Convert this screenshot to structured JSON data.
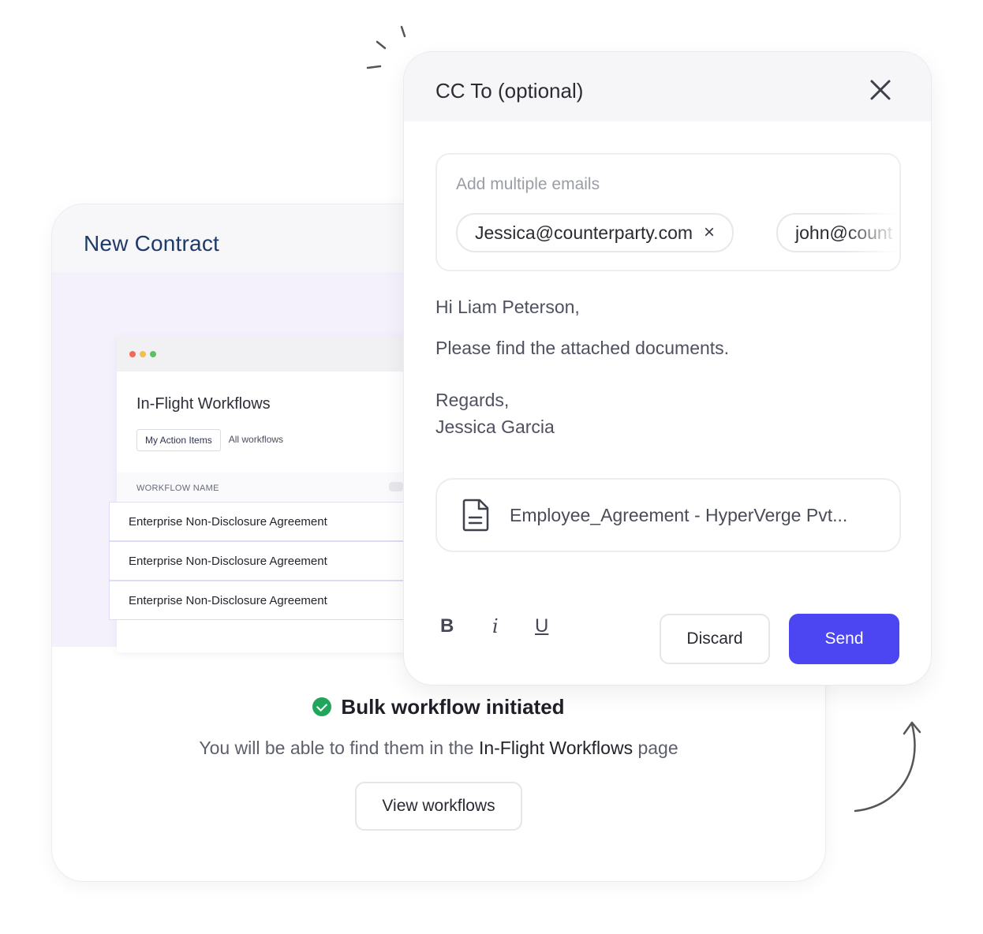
{
  "contract_card": {
    "title": "New Contract",
    "mini_window": {
      "title": "In-Flight Workflows",
      "tabs": [
        {
          "label": "My Action Items",
          "active": true
        },
        {
          "label": "All workflows",
          "active": false
        }
      ],
      "column_header": "WORKFLOW NAME",
      "rows": [
        "Enterprise Non-Disclosure Agreement",
        "Enterprise Non-Disclosure Agreement",
        "Enterprise Non-Disclosure Agreement"
      ]
    },
    "status": {
      "title": "Bulk workflow initiated",
      "subtitle_prefix": "You will be able to find them in the ",
      "subtitle_link": "In-Flight Workflows",
      "subtitle_suffix": " page",
      "button_label": "View workflows"
    }
  },
  "cc_modal": {
    "title": "CC To (optional)",
    "email_input": {
      "placeholder": "Add multiple emails",
      "chips": [
        "Jessica@counterparty.com",
        "john@count"
      ]
    },
    "message": {
      "greeting": "Hi Liam Peterson,",
      "body": "Please find the attached documents.",
      "regards": "Regards,",
      "sender": "Jessica Garcia"
    },
    "attachment_name": "Employee_Agreement - HyperVerge Pvt...",
    "formatting": {
      "bold": "B",
      "italic": "i",
      "underline": "U"
    },
    "discard_label": "Discard",
    "send_label": "Send"
  },
  "colors": {
    "accent": "#4b45f2",
    "success": "#22a45d",
    "hero_bg": "#f4f1fd",
    "title_blue": "#1f3a68"
  },
  "icons": {
    "close": "close-icon",
    "remove_chip": "close-icon",
    "attachment": "document-icon",
    "status": "check-circle-icon"
  }
}
